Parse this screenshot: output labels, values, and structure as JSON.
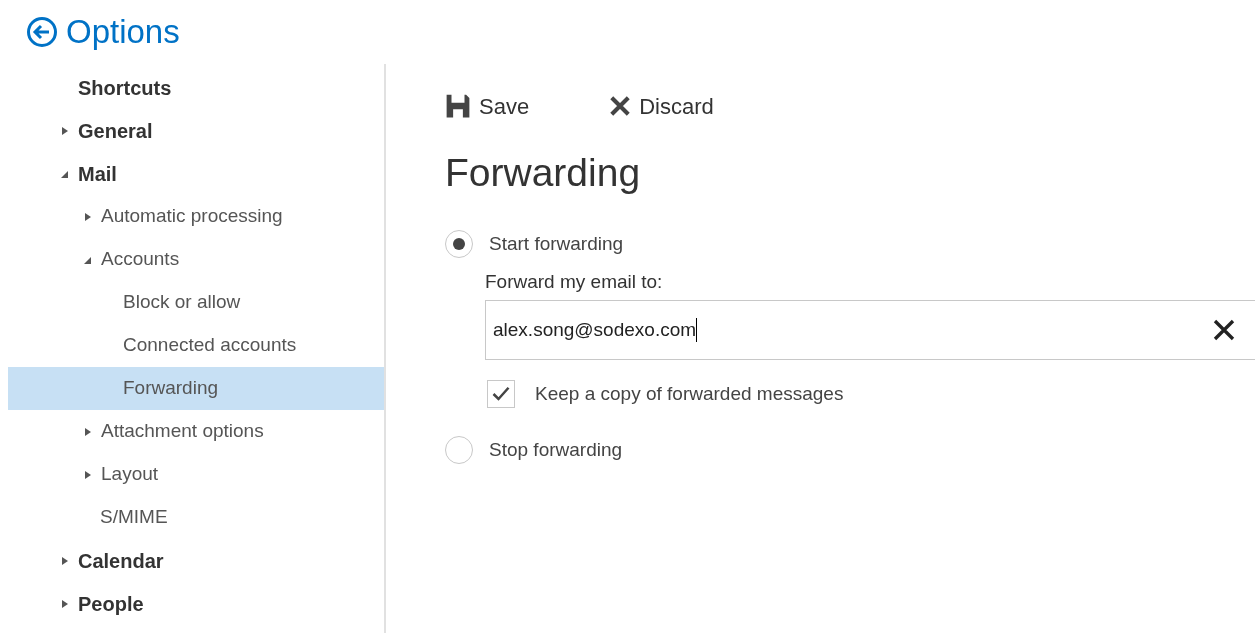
{
  "header": {
    "title": "Options"
  },
  "sidebar": {
    "items": [
      {
        "label": "Shortcuts",
        "kind": "page",
        "selected": false
      },
      {
        "label": "General",
        "kind": "group",
        "expanded": false,
        "selected": false
      },
      {
        "label": "Mail",
        "kind": "group",
        "expanded": true,
        "selected": false,
        "children": [
          {
            "label": "Automatic processing",
            "kind": "group",
            "expanded": false,
            "selected": false
          },
          {
            "label": "Accounts",
            "kind": "group",
            "expanded": true,
            "selected": false,
            "children": [
              {
                "label": "Block or allow",
                "kind": "page",
                "selected": false
              },
              {
                "label": "Connected accounts",
                "kind": "page",
                "selected": false
              },
              {
                "label": "Forwarding",
                "kind": "page",
                "selected": true
              }
            ]
          },
          {
            "label": "Attachment options",
            "kind": "group",
            "expanded": false,
            "selected": false
          },
          {
            "label": "Layout",
            "kind": "group",
            "expanded": false,
            "selected": false
          },
          {
            "label": "S/MIME",
            "kind": "page",
            "selected": false
          }
        ]
      },
      {
        "label": "Calendar",
        "kind": "group",
        "expanded": false,
        "selected": false
      },
      {
        "label": "People",
        "kind": "group",
        "expanded": false,
        "selected": false
      }
    ]
  },
  "toolbar": {
    "save": "Save",
    "discard": "Discard"
  },
  "content": {
    "heading": "Forwarding",
    "options": [
      {
        "label": "Start forwarding",
        "selected": true
      },
      {
        "label": "Stop forwarding",
        "selected": false
      }
    ],
    "field_label": "Forward my email to:",
    "email": "alex.song@sodexo.com",
    "keep_copy": {
      "label": "Keep a copy of forwarded messages",
      "checked": true
    }
  }
}
